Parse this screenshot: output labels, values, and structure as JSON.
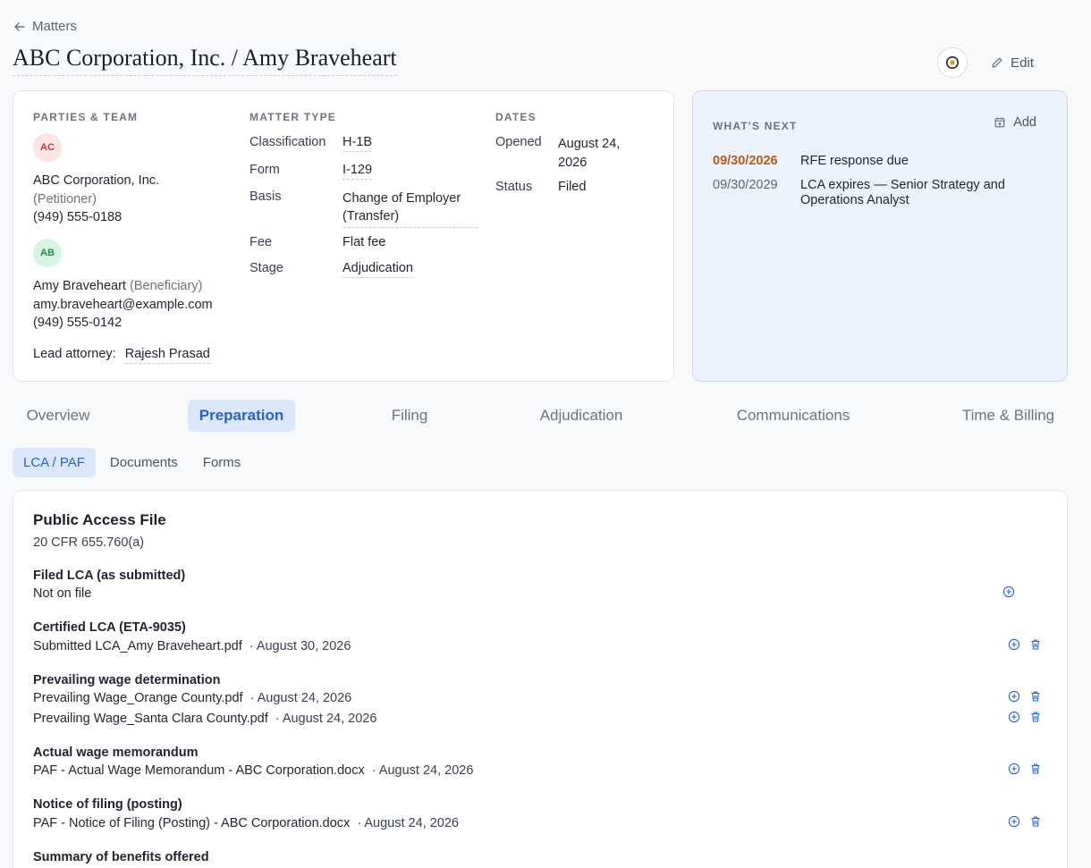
{
  "header": {
    "back_label": "Matters",
    "title": "ABC Corporation, Inc. / Amy Braveheart",
    "edit_label": "Edit"
  },
  "parties": {
    "heading": "PARTIES & TEAM",
    "petitioner": {
      "initials": "AC",
      "name": "ABC Corporation, Inc.",
      "role": "(Petitioner)",
      "phone": "(949) 555-0188"
    },
    "beneficiary": {
      "initials": "AB",
      "name": "Amy Braveheart",
      "role": "(Beneficiary)",
      "email": "amy.braveheart@example.com",
      "phone": "(949) 555-0142"
    },
    "lead_label": "Lead attorney:",
    "lead_value": "Rajesh Prasad"
  },
  "matter_type": {
    "heading": "MATTER TYPE",
    "rows": [
      {
        "label": "Classification",
        "value": "H-1B"
      },
      {
        "label": "Form",
        "value": "I-129"
      },
      {
        "label": "Basis",
        "value": "Change of Employer",
        "value2": "(Transfer)"
      },
      {
        "label": "Fee",
        "value": "Flat fee"
      },
      {
        "label": "Stage",
        "value": "Adjudication"
      }
    ]
  },
  "dates": {
    "heading": "DATES",
    "opened_label": "Opened",
    "opened_value": "August 24,",
    "opened_value2": "2026",
    "status_label": "Status",
    "status_value": "Filed"
  },
  "whats_next": {
    "heading": "WHAT'S NEXT",
    "add_label": "Add",
    "items": [
      {
        "date": "09/30/2026",
        "text": "RFE response due",
        "overdue": true
      },
      {
        "date": "09/30/2029",
        "text": "LCA expires — Senior Strategy and Operations Analyst",
        "overdue": false
      }
    ]
  },
  "tabs": [
    "Overview",
    "Preparation",
    "Filing",
    "Adjudication",
    "Communications",
    "Time & Billing"
  ],
  "active_tab": "Preparation",
  "subtabs": [
    "LCA / PAF",
    "Documents",
    "Forms"
  ],
  "active_subtab": "LCA / PAF",
  "paf": {
    "title": "Public Access File",
    "subtitle": "20 CFR 655.760(a)",
    "items": [
      {
        "title": "Filed LCA (as submitted)",
        "files": [
          {
            "name": "Not on file",
            "date": ""
          }
        ]
      },
      {
        "title": "Certified LCA (ETA-9035)",
        "files": [
          {
            "name": "Submitted LCA_Amy Braveheart.pdf",
            "date": "· August 30, 2026"
          }
        ]
      },
      {
        "title": "Prevailing wage determination",
        "files": [
          {
            "name": "Prevailing Wage_Orange County.pdf",
            "date": "· August 24, 2026"
          },
          {
            "name": "Prevailing Wage_Santa Clara County.pdf",
            "date": "· August 24, 2026"
          }
        ]
      },
      {
        "title": "Actual wage memorandum",
        "files": [
          {
            "name": "PAF - Actual Wage Memorandum - ABC Corporation.docx",
            "date": "· August 24, 2026"
          }
        ]
      },
      {
        "title": "Notice of filing (posting)",
        "files": [
          {
            "name": "PAF - Notice of Filing (Posting) - ABC Corporation.docx",
            "date": "· August 24, 2026"
          }
        ]
      },
      {
        "title": "Summary of benefits offered",
        "files": []
      }
    ]
  },
  "colors": {
    "accent": "#2563c9",
    "overdue": "#b55a18",
    "next_bg": "#edf3fd"
  }
}
